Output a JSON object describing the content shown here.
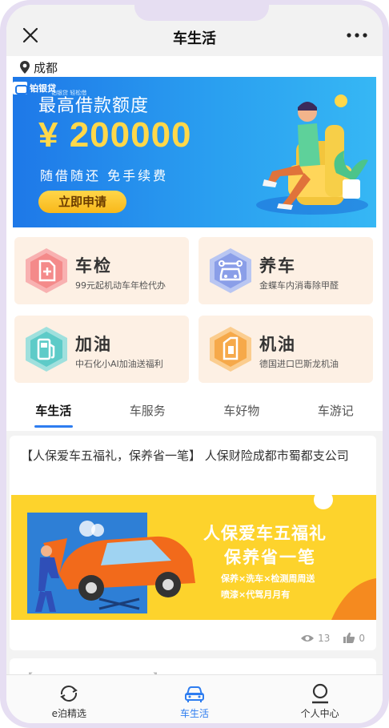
{
  "nav": {
    "title": "车生活"
  },
  "location": {
    "city": "成都"
  },
  "banner": {
    "brand": "铂银贷",
    "tagline": "铂银贷 轻松借",
    "headline": "最高借款额度",
    "amount": "¥ 200000",
    "subtitle": "随借随还  免手续费",
    "button": "立即申请",
    "colors": {
      "bg": "#1e78e8",
      "amount": "#ffd84a"
    }
  },
  "services": [
    {
      "title": "车检",
      "desc": "99元起机动车年检代办",
      "icon": "doc-plus-icon",
      "color": "#f48a8a"
    },
    {
      "title": "养车",
      "desc": "金蝶车内消毒除甲醛",
      "icon": "car-wrench-icon",
      "color": "#8a9ee8"
    },
    {
      "title": "加油",
      "desc": "中石化小AI加油送福利",
      "icon": "fuel-pump-icon",
      "color": "#5dcbc8"
    },
    {
      "title": "机油",
      "desc": "德国进口巴斯龙机油",
      "icon": "oil-can-icon",
      "color": "#f6a94a"
    }
  ],
  "tabs": [
    "车生活",
    "车服务",
    "车好物",
    "车游记"
  ],
  "article": {
    "title": "【人保爱车五福礼，保养省一笔】 人保财险成都市蜀都支公司",
    "image_headline1": "人保爱车五福礼",
    "image_headline2": "保养省一笔",
    "image_line1": "保养×洗车×检测周周送",
    "image_line2": "喷漆×代驾月月有",
    "views": "13",
    "likes": "0"
  },
  "article2": {
    "title": "【…………………………】…………………………"
  },
  "bottom_nav": [
    {
      "label": "e泊精选",
      "icon": "refresh-circle-icon"
    },
    {
      "label": "车生活",
      "icon": "car-icon"
    },
    {
      "label": "个人中心",
      "icon": "user-icon"
    }
  ]
}
